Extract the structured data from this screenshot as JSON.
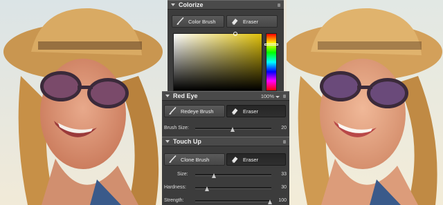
{
  "panels": {
    "colorize": {
      "title": "Colorize",
      "tools": [
        {
          "label": "Color Brush",
          "icon": "brush-icon",
          "active": false
        },
        {
          "label": "Eraser",
          "icon": "eraser-icon",
          "active": false
        }
      ],
      "picker": {
        "selected_color": "#e0c10a",
        "base_hue": "yellow"
      }
    },
    "red_eye": {
      "title": "Red Eye",
      "zoom": "100%",
      "tools": [
        {
          "label": "Redeye Brush",
          "icon": "brush-icon",
          "active": false
        },
        {
          "label": "Eraser",
          "icon": "eraser-icon",
          "active": true
        }
      ],
      "brush_size": {
        "label": "Brush Size:",
        "value": "20",
        "level": 0.55
      }
    },
    "touch_up": {
      "title": "Touch Up",
      "tools": [
        {
          "label": "Clone Brush",
          "icon": "brush-icon",
          "active": false
        },
        {
          "label": "Eraser",
          "icon": "eraser-icon",
          "active": true
        }
      ],
      "sliders": [
        {
          "label": "Size:",
          "value": "33",
          "level": 0.25
        },
        {
          "label": "Hardness:",
          "value": "30",
          "level": 0.15
        },
        {
          "label": "Strength:",
          "value": "100",
          "level": 1.0
        }
      ]
    }
  },
  "colors": {
    "panel_bg": "#3c3c3c",
    "header_bg": "#4a4a4a",
    "accent_yellow": "#e0c10a"
  }
}
